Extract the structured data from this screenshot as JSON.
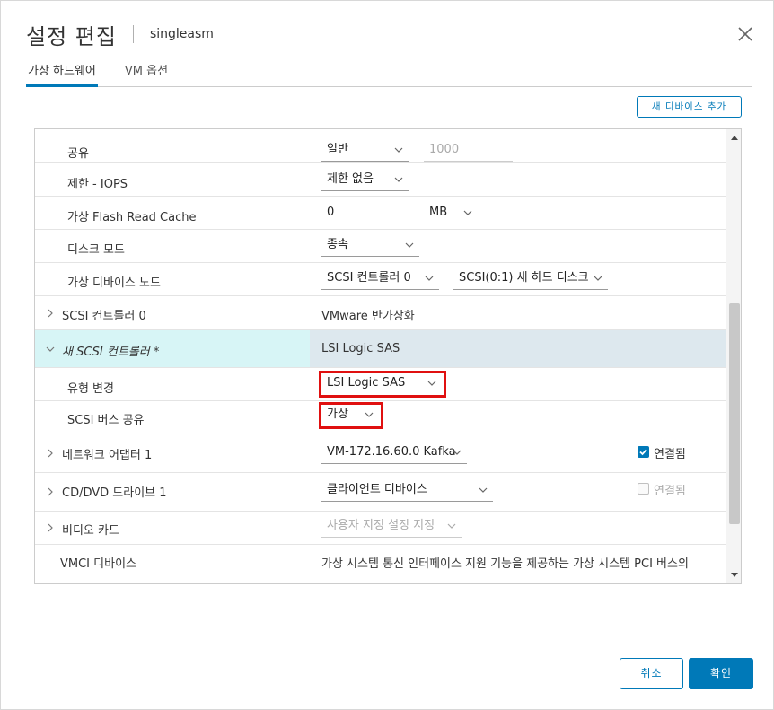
{
  "dialog": {
    "title": "설정 편집",
    "subtitle": "singleasm",
    "tabs": [
      {
        "label": "가상 하드웨어",
        "active": true
      },
      {
        "label": "VM 옵션",
        "active": false
      }
    ],
    "add_device_label": "새 디바이스 추가",
    "cancel_label": "취소",
    "ok_label": "확인",
    "accent_color": "#0079b8",
    "highlight_color": "#e01010"
  },
  "rows": {
    "share": {
      "label": "공유",
      "select": "일반",
      "input": "1000"
    },
    "limit_iops": {
      "label": "제한 - IOPS",
      "select": "제한 없음"
    },
    "flash_cache": {
      "label": "가상 Flash Read Cache",
      "input": "0",
      "unit": "MB"
    },
    "disk_mode": {
      "label": "디스크 모드",
      "select": "종속"
    },
    "vdev_node": {
      "label": "가상 디바이스 노드",
      "controller": "SCSI 컨트롤러 0",
      "node": "SCSI(0:1) 새 하드 디스크"
    },
    "scsi0": {
      "label": "SCSI 컨트롤러 0",
      "value": "VMware 반가상화"
    },
    "new_scsi": {
      "label": "새 SCSI 컨트롤러 *",
      "value": "LSI Logic SAS"
    },
    "change_type": {
      "label": "유형 변경",
      "select": "LSI Logic SAS"
    },
    "bus_share": {
      "label": "SCSI 버스 공유",
      "select": "가상"
    },
    "net_adapter": {
      "label": "네트워크 어댑터 1",
      "select": "VM-172.16.60.0 Kafka",
      "check_label": "연결됨",
      "checked": true
    },
    "cdrom": {
      "label": "CD/DVD 드라이브 1",
      "select": "클라이언트 디바이스",
      "check_label": "연결됨",
      "checked": false
    },
    "video": {
      "label": "비디오 카드",
      "select": "사용자 지정 설정 지정"
    },
    "vmci": {
      "label": "VMCI 디바이스",
      "value": "가상 시스템 통신 인터페이스 지원 기능을 제공하는 가상 시스템 PCI 버스의"
    }
  }
}
